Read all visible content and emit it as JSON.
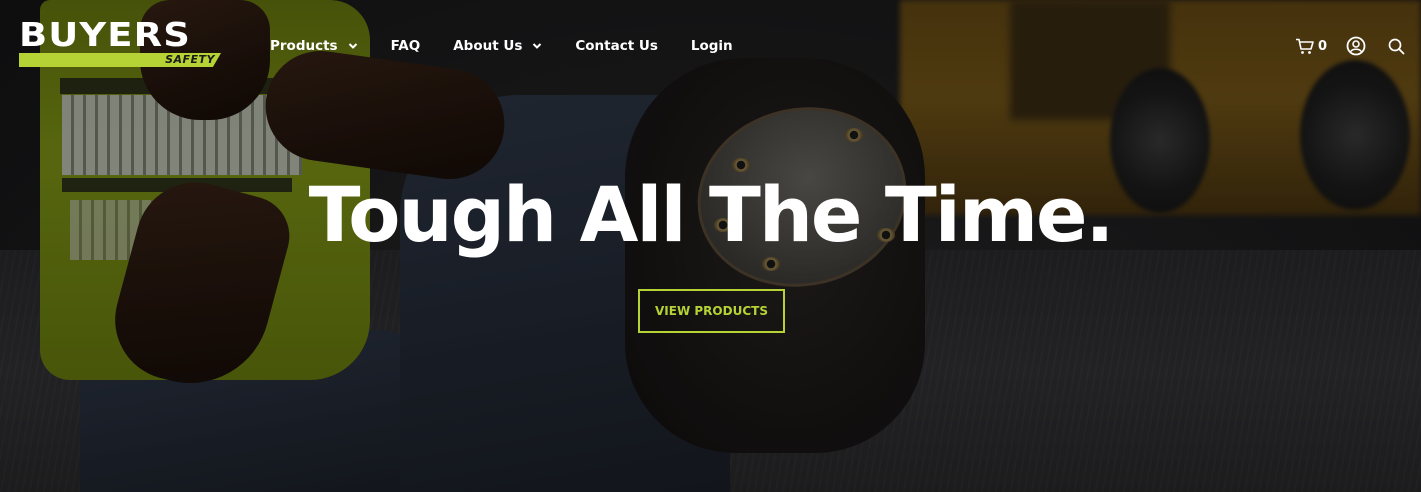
{
  "brand": {
    "name": "BUYERS",
    "tagline": "SAFETY",
    "accent_color": "#b5d334"
  },
  "nav": {
    "items": [
      {
        "label": "Products",
        "has_dropdown": true
      },
      {
        "label": "FAQ",
        "has_dropdown": false
      },
      {
        "label": "About Us",
        "has_dropdown": true
      },
      {
        "label": "Contact Us",
        "has_dropdown": false
      },
      {
        "label": "Login",
        "has_dropdown": false
      }
    ]
  },
  "header_icons": {
    "cart_icon": "cart-icon",
    "cart_count": "0",
    "account_icon": "account-icon",
    "search_icon": "search-icon"
  },
  "hero": {
    "headline": "Tough All The Time.",
    "cta_label": "VIEW PRODUCTS"
  }
}
